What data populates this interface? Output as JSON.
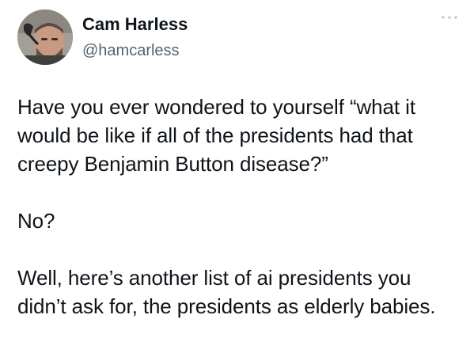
{
  "author": {
    "display_name": "Cam Harless",
    "handle": "@hamcarless",
    "avatar_icon": "profile-photo"
  },
  "menu": {
    "icon": "more-dots-icon"
  },
  "tweet": {
    "paragraphs": [
      "Have you ever wondered to yourself “what it would be like if all of the presidents had that creepy Benjamin Button disease?”",
      "No?",
      "Well, here’s another list of ai presidents you didn’t ask for, the presidents as elderly babies."
    ]
  },
  "colors": {
    "text": "#0f1419",
    "secondary": "#536471",
    "background": "#ffffff"
  }
}
